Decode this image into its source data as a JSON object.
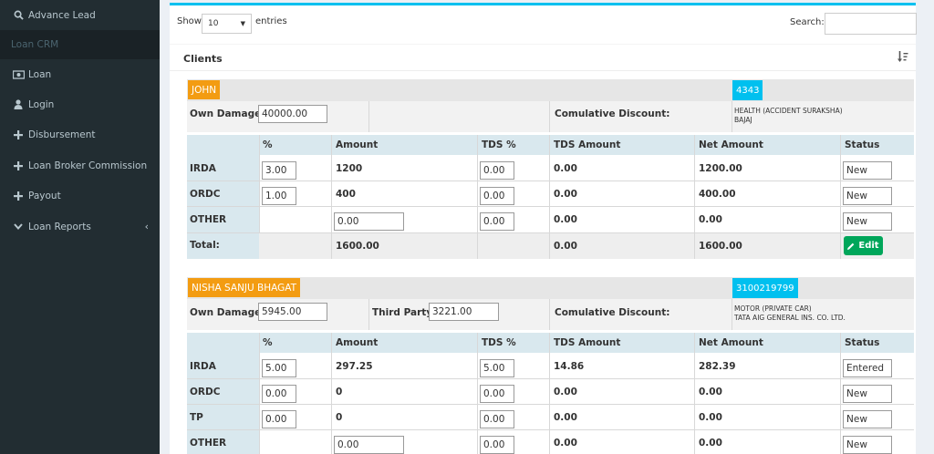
{
  "sidebar": {
    "items": [
      {
        "label": "Advance Lead",
        "icon": "search-icon"
      },
      {
        "label": "Loan",
        "icon": "money-icon"
      },
      {
        "label": "Login",
        "icon": "user-icon"
      },
      {
        "label": "Disbursement",
        "icon": "plus-icon"
      },
      {
        "label": "Loan Broker Commission",
        "icon": "plus-icon"
      },
      {
        "label": "Payout",
        "icon": "plus-icon"
      },
      {
        "label": "Loan Reports",
        "icon": "chevron-down-icon"
      }
    ],
    "header": "Loan CRM"
  },
  "controls": {
    "show_label": "Show",
    "page_size": "10",
    "entries_label": "entries",
    "search_label": "Search:"
  },
  "clients_title": "Clients",
  "columns": [
    "%",
    "Amount",
    "TDS %",
    "TDS Amount",
    "Net Amount",
    "Status"
  ],
  "clients": [
    {
      "name": "JOHN",
      "id": "4343",
      "own_damage_label": "Own Damage:",
      "own_damage": "40000.00",
      "cumulative_label": "Comulative Discount:",
      "policy_type": "HEALTH (ACCIDENT SURAKSHA)",
      "insurer": "BAJAJ",
      "rows": [
        {
          "name": "IRDA",
          "pct": "3.00",
          "amount": "1200",
          "tds_pct": "0.00",
          "tds_amount": "0.00",
          "net": "1200.00",
          "status": "New"
        },
        {
          "name": "ORDC",
          "pct": "1.00",
          "amount": "400",
          "tds_pct": "0.00",
          "tds_amount": "0.00",
          "net": "400.00",
          "status": "New"
        },
        {
          "name": "OTHER",
          "pct": "",
          "amount": "0.00",
          "tds_pct": "0.00",
          "tds_amount": "0.00",
          "net": "0.00",
          "status": "New"
        }
      ],
      "total": {
        "label": "Total:",
        "amount": "1600.00",
        "tds_amount": "0.00",
        "net": "1600.00"
      },
      "edit_label": "Edit"
    },
    {
      "name": "NISHA SANJU BHAGAT",
      "id": "3100219799",
      "own_damage_label": "Own Damage:",
      "own_damage": "5945.00",
      "third_party_label": "Third Party:",
      "third_party": "3221.00",
      "cumulative_label": "Comulative Discount:",
      "policy_type": "MOTOR (PRIVATE CAR)",
      "insurer": "TATA AIG GENERAL INS. CO. LTD.",
      "rows": [
        {
          "name": "IRDA",
          "pct": "5.00",
          "amount": "297.25",
          "tds_pct": "5.00",
          "tds_amount": "14.86",
          "net": "282.39",
          "status": "Entered"
        },
        {
          "name": "ORDC",
          "pct": "0.00",
          "amount": "0",
          "tds_pct": "0.00",
          "tds_amount": "0.00",
          "net": "0.00",
          "status": "New"
        },
        {
          "name": "TP",
          "pct": "0.00",
          "amount": "0",
          "tds_pct": "0.00",
          "tds_amount": "0.00",
          "net": "0.00",
          "status": "New"
        },
        {
          "name": "OTHER",
          "pct": "",
          "amount": "0.00",
          "tds_pct": "0.00",
          "tds_amount": "0.00",
          "net": "0.00",
          "status": "New"
        }
      ]
    }
  ]
}
